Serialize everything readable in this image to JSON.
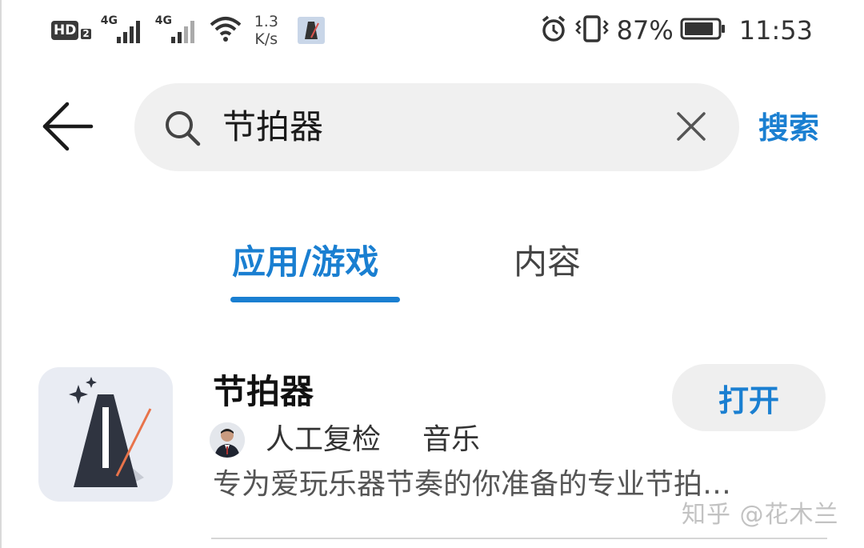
{
  "status_bar": {
    "hd_label": "HD",
    "hd_sub": "2",
    "net1_label": "4G",
    "net2_label": "4G",
    "wifi_icon": "wifi-icon",
    "speed_value": "1.3",
    "speed_unit": "K/s",
    "alarm_icon": "alarm-icon",
    "vibrate_icon": "vibrate-icon",
    "battery_percent": "87%",
    "battery_level": 0.87,
    "time": "11:53"
  },
  "search": {
    "query": "节拍器",
    "search_button_label": "搜索",
    "back_icon": "back-arrow-icon",
    "clear_icon": "close-icon"
  },
  "tabs": [
    {
      "label": "应用/游戏",
      "active": true
    },
    {
      "label": "内容",
      "active": false
    }
  ],
  "results": [
    {
      "name": "节拍器",
      "developer": "人工复检",
      "category": "音乐",
      "description": "专为爱玩乐器节奏的你准备的专业节拍…",
      "action_label": "打开",
      "icon": "metronome-icon"
    }
  ],
  "watermark": "知乎 @花木兰",
  "colors": {
    "accent": "#1a7fd1",
    "search_bg": "#f0f0f0",
    "button_bg": "#efefef"
  }
}
